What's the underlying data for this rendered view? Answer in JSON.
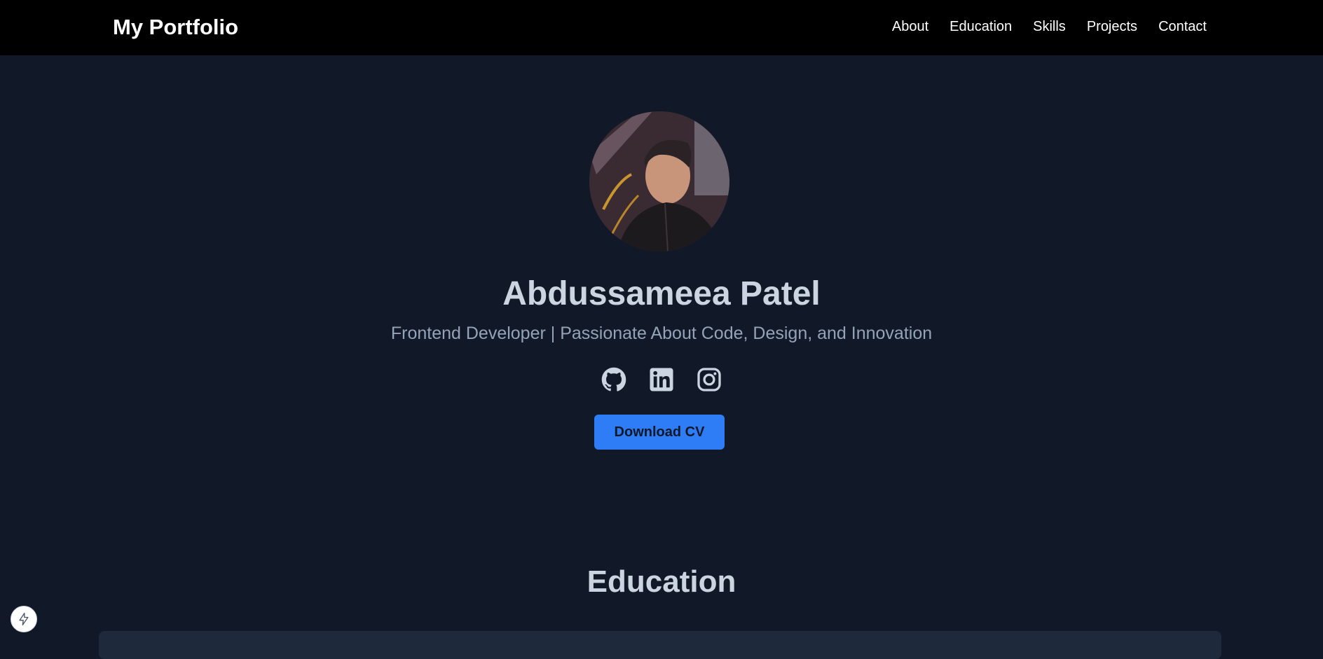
{
  "navbar": {
    "brand": "My Portfolio",
    "links": [
      {
        "label": "About"
      },
      {
        "label": "Education"
      },
      {
        "label": "Skills"
      },
      {
        "label": "Projects"
      },
      {
        "label": "Contact"
      }
    ]
  },
  "hero": {
    "name": "Abdussameea Patel",
    "tagline": "Frontend Developer | Passionate About Code, Design, and Innovation",
    "socials": [
      {
        "icon": "github-icon"
      },
      {
        "icon": "linkedin-icon"
      },
      {
        "icon": "instagram-icon"
      }
    ],
    "cv_button": "Download CV"
  },
  "education": {
    "title": "Education"
  },
  "colors": {
    "navbar": "#000000",
    "background": "#111827",
    "accent": "#2e7cf6",
    "heading": "#cbd5e1",
    "muted": "#94a3b8",
    "card": "#1e293b"
  }
}
